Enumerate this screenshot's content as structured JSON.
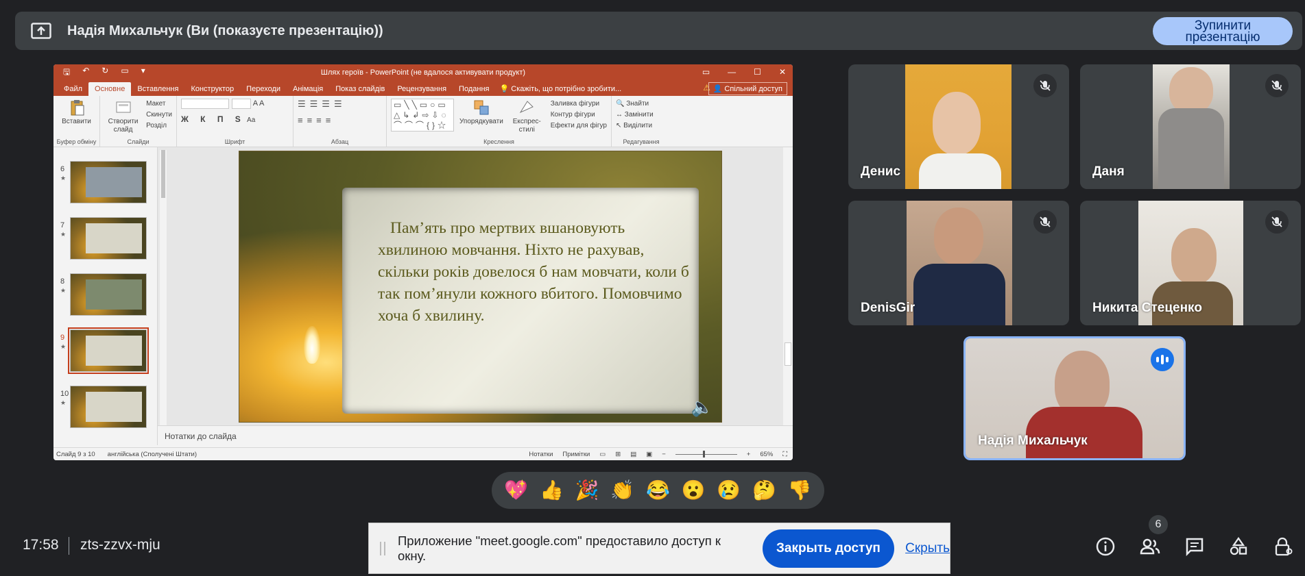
{
  "banner": {
    "title": "Надія Михальчук (Ви (показуєте презентацію))",
    "stop_button": "Зупинити презентацію",
    "icon": "present-to-all-icon"
  },
  "ppt": {
    "window_title": "Шлях героїв - PowerPoint (не вдалося активувати продукт)",
    "menu": [
      "Файл",
      "Основне",
      "Вставлення",
      "Конструктор",
      "Переходи",
      "Анімація",
      "Показ слайдів",
      "Рецензування",
      "Подання"
    ],
    "active_menu": "Основне",
    "tell_me": "Скажіть, що потрібно зробити...",
    "share": "Спільний доступ",
    "ribbon": {
      "paste": "Вставити",
      "clipboard": "Буфер обміну",
      "new_slide": "Створити слайд",
      "layout": "Макет",
      "reset": "Скинути",
      "section": "Розділ",
      "slides": "Слайди",
      "font": "Шрифт",
      "paragraph": "Абзац",
      "arrange": "Упорядкувати",
      "quick_styles": "Експрес-стилі",
      "shape_fill": "Заливка фігури",
      "shape_outline": "Контур фігури",
      "shape_effects": "Ефекти для фігур",
      "drawing": "Креслення",
      "find": "Знайти",
      "replace": "Замінити",
      "select": "Виділити",
      "editing": "Редагування",
      "format_buttons": "Ж К П S",
      "aa": "Aa"
    },
    "thumbnails": [
      {
        "num": "6",
        "star": "★"
      },
      {
        "num": "7",
        "star": "★"
      },
      {
        "num": "8",
        "star": "★"
      },
      {
        "num": "9",
        "star": "★"
      },
      {
        "num": "10",
        "star": "★"
      }
    ],
    "selected_slide": "9",
    "slide_text": "Пам’ять про мертвих вшановують хвилиною мовчання. Ніхто не рахував, скільки років довелося б нам мовчати, коли б так пом’янули кожного вбитого. Помовчимо хоча б хвилину.",
    "notes_placeholder": "Нотатки до слайда",
    "status": {
      "slide": "Слайд 9 з 10",
      "language": "англійська (Сполучені Штати)",
      "notes": "Нотатки",
      "comments": "Примітки",
      "zoom": "65%"
    }
  },
  "participants": [
    {
      "name": "Денис",
      "muted": true
    },
    {
      "name": "Даня",
      "muted": true
    },
    {
      "name": "DenisGir",
      "muted": true
    },
    {
      "name": "Никита Стеценко",
      "muted": true
    },
    {
      "name": "Надія Михальчук",
      "speaking": true
    }
  ],
  "reactions": [
    "💖",
    "👍",
    "🎉",
    "👏",
    "😂",
    "😮",
    "😢",
    "🤔",
    "👎"
  ],
  "bottom": {
    "time": "17:58",
    "meeting_code": "zts-zzvx-mju",
    "people_count": "6"
  },
  "infobar": {
    "message": "Приложение \"meet.google.com\" предоставило доступ к окну.",
    "close_button": "Закрыть доступ",
    "hide_link": "Скрыть"
  },
  "colors": {
    "background": "#202124",
    "tile": "#3c4043",
    "accent": "#a8c7fa",
    "ppt_brand": "#b7472a",
    "primary_button": "#0b57d0"
  }
}
